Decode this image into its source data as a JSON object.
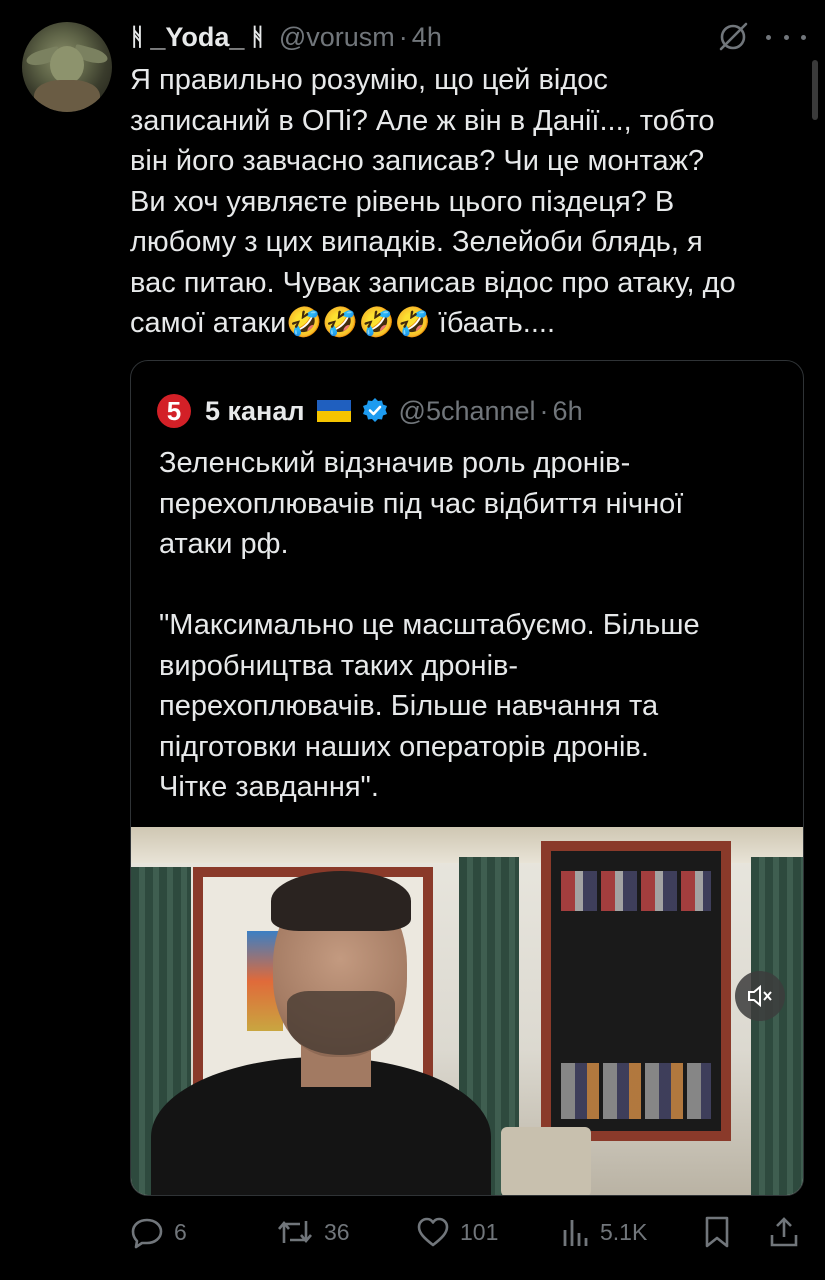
{
  "author": {
    "rune_left": "ᚻ",
    "display_name": "_Yoda_",
    "rune_right": "ᚻ",
    "handle": "@vorusm",
    "separator": "·",
    "time": "4h",
    "avatar_icon": "yoda-avatar"
  },
  "tweet": {
    "text": "Я правильно розумію, що цей відос\nзаписаний в ОПі? Але ж він в Данії..., тобто\nвін його завчасно записав? Чи це монтаж?\nВи хоч уявляєте рівень цього піздеця? В\nлюбому з цих випадків. Зелейоби блядь, я\nвас питаю. Чувак записав відос про атаку, до\nсамої атаки🤣🤣🤣🤣 їбаать...."
  },
  "quote": {
    "logo_text": "5",
    "name": "5 канал",
    "flag": "ukraine-flag",
    "verified_icon": "verified-badge-icon",
    "handle": "@5channel",
    "separator": "·",
    "time": "6h",
    "text": "Зеленський відзначив роль дронів-\nперехоплювачів під час відбиття нічної\nатаки рф.\n\n\"Максимально це масштабуємо. Більше\nвиробництва таких дронів-\nперехоплювачів. Більше навчання та\nпідготовки наших операторів дронів.\nЧітке завдання\"."
  },
  "actions": {
    "replies": "6",
    "reposts": "36",
    "likes": "101",
    "views": "5.1K"
  },
  "colors": {
    "background": "#000000",
    "text": "#e7e9ea",
    "muted": "#71767b",
    "border": "#2f3336",
    "verified": "#1d9bf0",
    "channel_red": "#d32027"
  }
}
